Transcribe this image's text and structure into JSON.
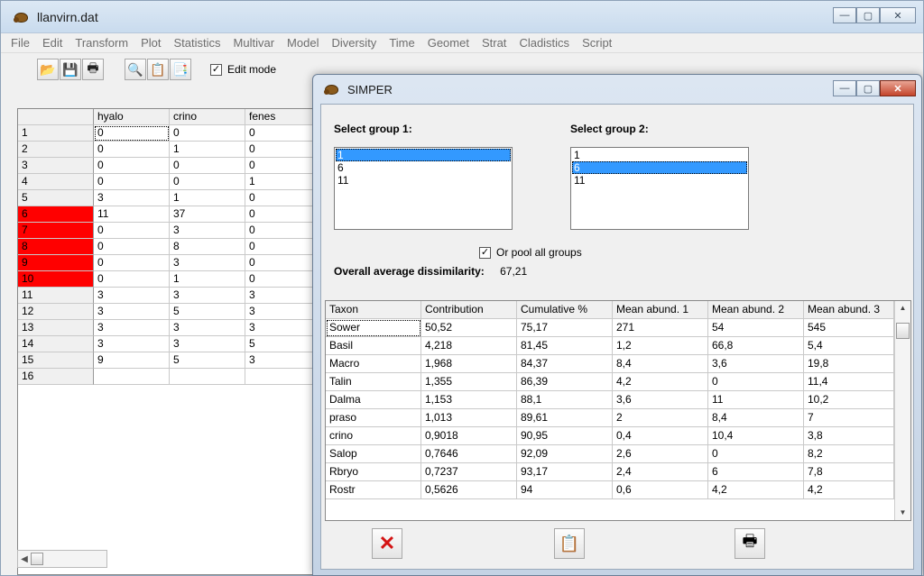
{
  "main_window": {
    "title": "llanvirn.dat",
    "controls": {
      "minimize": "—",
      "maximize": "▢",
      "close": "✕"
    }
  },
  "menu": [
    "File",
    "Edit",
    "Transform",
    "Plot",
    "Statistics",
    "Multivar",
    "Model",
    "Diversity",
    "Time",
    "Geomet",
    "Strat",
    "Cladistics",
    "Script"
  ],
  "toolbar": {
    "icons": [
      "open-icon",
      "save-icon",
      "print-icon",
      "find-icon",
      "copy-icon",
      "paste-icon"
    ],
    "glyphs": [
      "📂",
      "💾",
      "🖶",
      "🔍",
      "📋",
      "📑"
    ],
    "edit_mode_label": "Edit mode",
    "edit_mode_checked": "✓"
  },
  "grid": {
    "headers": [
      "",
      "hyalo",
      "crino",
      "fenes"
    ],
    "rows": [
      {
        "label": "1",
        "vals": [
          "0",
          "0",
          "0"
        ],
        "red": false
      },
      {
        "label": "2",
        "vals": [
          "0",
          "1",
          "0"
        ],
        "red": false
      },
      {
        "label": "3",
        "vals": [
          "0",
          "0",
          "0"
        ],
        "red": false
      },
      {
        "label": "4",
        "vals": [
          "0",
          "0",
          "1"
        ],
        "red": false
      },
      {
        "label": "5",
        "vals": [
          "3",
          "1",
          "0"
        ],
        "red": false
      },
      {
        "label": "6",
        "vals": [
          "11",
          "37",
          "0"
        ],
        "red": true
      },
      {
        "label": "7",
        "vals": [
          "0",
          "3",
          "0"
        ],
        "red": true
      },
      {
        "label": "8",
        "vals": [
          "0",
          "8",
          "0"
        ],
        "red": true
      },
      {
        "label": "9",
        "vals": [
          "0",
          "3",
          "0"
        ],
        "red": true
      },
      {
        "label": "10",
        "vals": [
          "0",
          "1",
          "0"
        ],
        "red": true
      },
      {
        "label": "11",
        "vals": [
          "3",
          "3",
          "3"
        ],
        "red": false
      },
      {
        "label": "12",
        "vals": [
          "3",
          "5",
          "3"
        ],
        "red": false
      },
      {
        "label": "13",
        "vals": [
          "3",
          "3",
          "3"
        ],
        "red": false
      },
      {
        "label": "14",
        "vals": [
          "3",
          "3",
          "5"
        ],
        "red": false
      },
      {
        "label": "15",
        "vals": [
          "9",
          "5",
          "3"
        ],
        "red": false
      },
      {
        "label": "16",
        "vals": [
          "",
          "",
          ""
        ],
        "red": false
      }
    ]
  },
  "simper": {
    "title": "SIMPER",
    "group1_label": "Select group 1:",
    "group2_label": "Select group 2:",
    "group1_items": [
      "1",
      "6",
      "11"
    ],
    "group1_selected": "1",
    "group2_items": [
      "1",
      "6",
      "11"
    ],
    "group2_selected": "6",
    "pool_label": "Or pool all groups",
    "pool_checked": "✓",
    "overall_label": "Overall average dissimilarity:",
    "overall_value": "67,21",
    "table_headers": [
      "Taxon",
      "Contribution",
      "Cumulative %",
      "Mean abund. 1",
      "Mean abund. 2",
      "Mean abund. 3"
    ],
    "table_rows": [
      [
        "Sower",
        "50,52",
        "75,17",
        "271",
        "54",
        "545"
      ],
      [
        "Basil",
        "4,218",
        "81,45",
        "1,2",
        "66,8",
        "5,4"
      ],
      [
        "Macro",
        "1,968",
        "84,37",
        "8,4",
        "3,6",
        "19,8"
      ],
      [
        "Talin",
        "1,355",
        "86,39",
        "4,2",
        "0",
        "11,4"
      ],
      [
        "Dalma",
        "1,153",
        "88,1",
        "3,6",
        "11",
        "10,2"
      ],
      [
        "praso",
        "1,013",
        "89,61",
        "2",
        "8,4",
        "7"
      ],
      [
        "crino",
        "0,9018",
        "90,95",
        "0,4",
        "10,4",
        "3,8"
      ],
      [
        "Salop",
        "0,7646",
        "92,09",
        "2,6",
        "0",
        "8,2"
      ],
      [
        "Rbryo",
        "0,7237",
        "93,17",
        "2,4",
        "6",
        "7,8"
      ],
      [
        "Rostr",
        "0,5626",
        "94",
        "0,6",
        "4,2",
        "4,2"
      ]
    ],
    "buttons": {
      "cancel": "✕",
      "copy": "📋",
      "print": "🖶"
    }
  },
  "colors": {
    "selected": "#3399ff",
    "red_row": "#ff0000"
  }
}
